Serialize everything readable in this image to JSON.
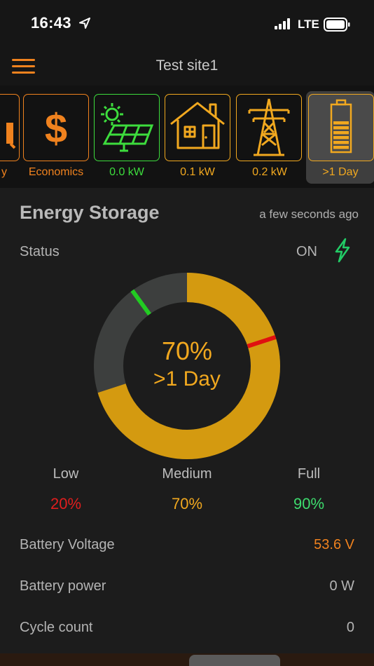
{
  "status_bar": {
    "time": "16:43",
    "network": "LTE"
  },
  "header": {
    "title": "Test site1"
  },
  "tiles": [
    {
      "id": "partial",
      "label": "y",
      "color": "#f0821e"
    },
    {
      "id": "economics",
      "label": "Economics",
      "color": "#f0821e",
      "icon": "dollar-icon"
    },
    {
      "id": "solar",
      "label": "0.0  kW",
      "color": "#3ddc3d",
      "icon": "solar-panel-icon"
    },
    {
      "id": "home",
      "label": "0.1  kW",
      "color": "#f1a81f",
      "icon": "house-icon"
    },
    {
      "id": "grid",
      "label": "0.2  kW",
      "color": "#f1a81f",
      "icon": "power-tower-icon"
    },
    {
      "id": "battery",
      "label": ">1 Day",
      "color": "#f1a81f",
      "icon": "battery-icon",
      "selected": true
    }
  ],
  "storage": {
    "title": "Energy Storage",
    "updated": "a few seconds ago",
    "status_label": "Status",
    "status_value": "ON",
    "charge_percent": "70%",
    "duration": ">1 Day",
    "charge_fraction": 0.7,
    "levels": [
      {
        "label": "Low",
        "value": "20%",
        "color": "#e01e1e"
      },
      {
        "label": "Medium",
        "value": "70%",
        "color": "#f1a81f"
      },
      {
        "label": "Full",
        "value": "90%",
        "color": "#3ddc6e"
      }
    ],
    "rows": [
      {
        "label": "Battery Voltage",
        "value": "53.6 V",
        "color": "#f0821e"
      },
      {
        "label": "Battery power",
        "value": "0 W",
        "color": "#b4b4b4"
      },
      {
        "label": "Cycle count",
        "value": "0",
        "color": "#b4b4b4"
      }
    ]
  },
  "colors": {
    "accent": "#f0821e",
    "charge": "#d49a10",
    "track": "#3d3f3e",
    "green": "#22cc22",
    "red": "#e01010"
  }
}
